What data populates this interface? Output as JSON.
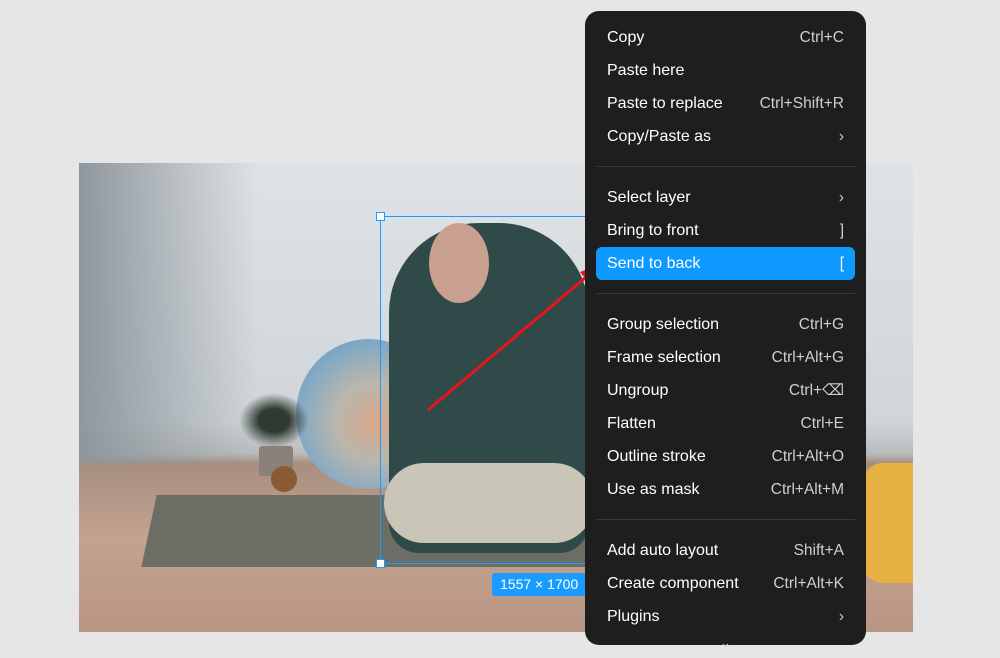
{
  "canvas": {
    "selection_size": "1557 × 1700",
    "accent": "#0d99ff",
    "arrow_color": "#e8141b"
  },
  "menu": {
    "groups": [
      [
        {
          "label": "Copy",
          "shortcut": "Ctrl+C"
        },
        {
          "label": "Paste here",
          "shortcut": ""
        },
        {
          "label": "Paste to replace",
          "shortcut": "Ctrl+Shift+R"
        },
        {
          "label": "Copy/Paste as",
          "shortcut": "›"
        }
      ],
      [
        {
          "label": "Select layer",
          "shortcut": "›"
        },
        {
          "label": "Bring to front",
          "shortcut": "]"
        },
        {
          "label": "Send to back",
          "shortcut": "[",
          "active": true
        }
      ],
      [
        {
          "label": "Group selection",
          "shortcut": "Ctrl+G"
        },
        {
          "label": "Frame selection",
          "shortcut": "Ctrl+Alt+G"
        },
        {
          "label": "Ungroup",
          "shortcut": "Ctrl+⌫"
        },
        {
          "label": "Flatten",
          "shortcut": "Ctrl+E"
        },
        {
          "label": "Outline stroke",
          "shortcut": "Ctrl+Alt+O"
        },
        {
          "label": "Use as mask",
          "shortcut": "Ctrl+Alt+M"
        }
      ],
      [
        {
          "label": "Add auto layout",
          "shortcut": "Shift+A"
        },
        {
          "label": "Create component",
          "shortcut": "Ctrl+Alt+K"
        },
        {
          "label": "Plugins",
          "shortcut": "›"
        }
      ]
    ],
    "more": "⌄"
  }
}
